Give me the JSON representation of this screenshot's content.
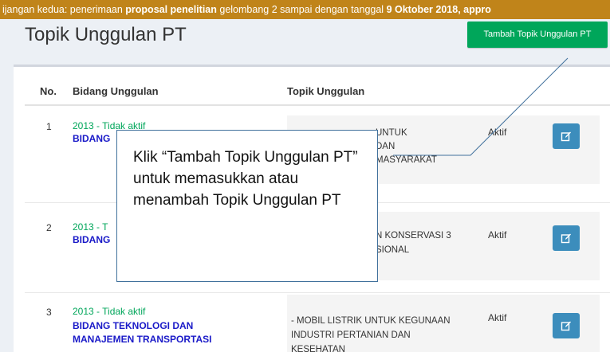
{
  "marquee": {
    "p1": "ijangan kedua: penerimaan ",
    "b1": "proposal penelitian",
    "p2": " gelombang 2 sampai dengan tanggal ",
    "b2": "9 Oktober 2018, appro"
  },
  "page_title": "Topik Unggulan PT",
  "add_button_label": "Tambah Topik Unggulan PT",
  "table": {
    "headers": [
      "No.",
      "Bidang Unggulan",
      "Topik Unggulan"
    ],
    "rows": [
      {
        "no": "1",
        "year": "2013 - Tidak aktif",
        "bidang": [
          "BIDANG"
        ],
        "topik": [
          "UNTUK",
          "DAN",
          "MASYARAKAT"
        ],
        "status": "Aktif"
      },
      {
        "no": "2",
        "year": "2013 - T",
        "bidang": [
          "BIDANG"
        ],
        "topik": [
          "N KONSERVASI 3",
          "SIONAL"
        ],
        "status": "Aktif"
      },
      {
        "no": "3",
        "year": "2013 - Tidak aktif",
        "bidang": [
          "BIDANG TEKNOLOGI DAN",
          "MANAJEMEN TRANSPORTASI"
        ],
        "topik": [
          "- MOBIL LISTRIK UNTUK KEGUNAAN",
          "INDUSTRI PERTANIAN DAN",
          "KESEHATAN"
        ],
        "status": "Aktif"
      }
    ]
  },
  "callout_text": "Klik “Tambah Topik Unggulan PT” untuk memasukkan atau menambah Topik Unggulan PT",
  "colors": {
    "marquee_bg": "#c0841a",
    "add_button": "#00a65a",
    "edit_button": "#3c8dbc",
    "year_text": "#00a65a",
    "bidang_text": "#1a1ac8"
  },
  "icons": {
    "edit": "edit-icon"
  }
}
